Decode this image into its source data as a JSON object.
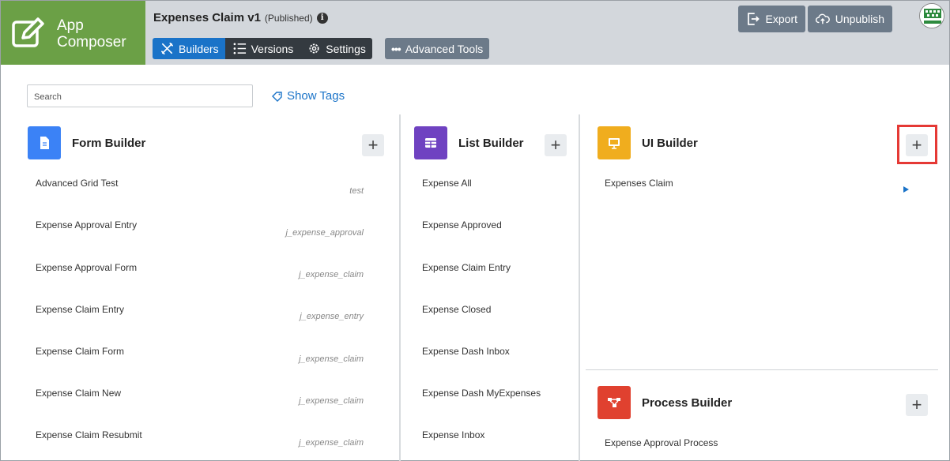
{
  "brand": {
    "line1": "App",
    "line2": "Composer"
  },
  "app": {
    "title": "Expenses Claim v1",
    "status": "(Published)"
  },
  "tabs": [
    {
      "label": "Builders"
    },
    {
      "label": "Versions"
    },
    {
      "label": "Settings"
    }
  ],
  "advanced": {
    "label": "Advanced Tools"
  },
  "header_buttons": {
    "export": "Export",
    "unpublish": "Unpublish"
  },
  "search": {
    "placeholder": "Search"
  },
  "show_tags": "Show Tags",
  "colors": {
    "brand": "#6ba046",
    "active_tab": "#1a73c8",
    "form": "#3b82f6",
    "list": "#6f42c1",
    "ui": "#f0ad1e",
    "process": "#e0412f"
  },
  "form_builder": {
    "title": "Form Builder",
    "items": [
      {
        "name": "Advanced Grid Test",
        "tag": "test"
      },
      {
        "name": "Expense Approval Entry",
        "tag": "j_expense_approval"
      },
      {
        "name": "Expense Approval Form",
        "tag": "j_expense_claim"
      },
      {
        "name": "Expense Claim Entry",
        "tag": "j_expense_entry"
      },
      {
        "name": "Expense Claim Form",
        "tag": "j_expense_claim"
      },
      {
        "name": "Expense Claim New",
        "tag": "j_expense_claim"
      },
      {
        "name": "Expense Claim Resubmit",
        "tag": "j_expense_claim"
      }
    ]
  },
  "list_builder": {
    "title": "List Builder",
    "items": [
      "Expense All",
      "Expense Approved",
      "Expense Claim Entry",
      "Expense Closed",
      "Expense Dash Inbox",
      "Expense Dash MyExpenses",
      "Expense Inbox"
    ]
  },
  "ui_builder": {
    "title": "UI Builder",
    "items": [
      "Expenses Claim"
    ]
  },
  "process_builder": {
    "title": "Process Builder",
    "items": [
      "Expense Approval Process"
    ]
  }
}
